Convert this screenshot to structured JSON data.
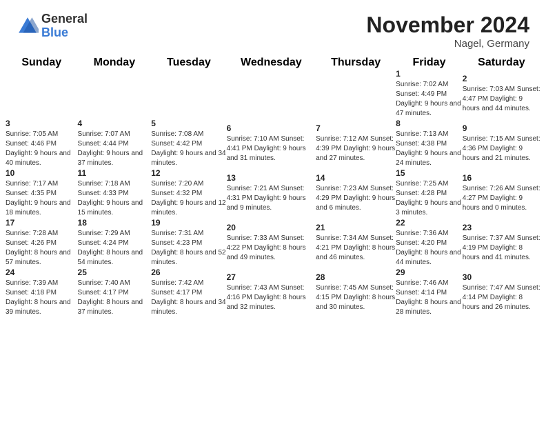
{
  "logo": {
    "general": "General",
    "blue": "Blue"
  },
  "title": "November 2024",
  "location": "Nagel, Germany",
  "days_of_week": [
    "Sunday",
    "Monday",
    "Tuesday",
    "Wednesday",
    "Thursday",
    "Friday",
    "Saturday"
  ],
  "weeks": [
    [
      {
        "day": "",
        "info": ""
      },
      {
        "day": "",
        "info": ""
      },
      {
        "day": "",
        "info": ""
      },
      {
        "day": "",
        "info": ""
      },
      {
        "day": "",
        "info": ""
      },
      {
        "day": "1",
        "info": "Sunrise: 7:02 AM\nSunset: 4:49 PM\nDaylight: 9 hours and 47 minutes."
      },
      {
        "day": "2",
        "info": "Sunrise: 7:03 AM\nSunset: 4:47 PM\nDaylight: 9 hours and 44 minutes."
      }
    ],
    [
      {
        "day": "3",
        "info": "Sunrise: 7:05 AM\nSunset: 4:46 PM\nDaylight: 9 hours and 40 minutes."
      },
      {
        "day": "4",
        "info": "Sunrise: 7:07 AM\nSunset: 4:44 PM\nDaylight: 9 hours and 37 minutes."
      },
      {
        "day": "5",
        "info": "Sunrise: 7:08 AM\nSunset: 4:42 PM\nDaylight: 9 hours and 34 minutes."
      },
      {
        "day": "6",
        "info": "Sunrise: 7:10 AM\nSunset: 4:41 PM\nDaylight: 9 hours and 31 minutes."
      },
      {
        "day": "7",
        "info": "Sunrise: 7:12 AM\nSunset: 4:39 PM\nDaylight: 9 hours and 27 minutes."
      },
      {
        "day": "8",
        "info": "Sunrise: 7:13 AM\nSunset: 4:38 PM\nDaylight: 9 hours and 24 minutes."
      },
      {
        "day": "9",
        "info": "Sunrise: 7:15 AM\nSunset: 4:36 PM\nDaylight: 9 hours and 21 minutes."
      }
    ],
    [
      {
        "day": "10",
        "info": "Sunrise: 7:17 AM\nSunset: 4:35 PM\nDaylight: 9 hours and 18 minutes."
      },
      {
        "day": "11",
        "info": "Sunrise: 7:18 AM\nSunset: 4:33 PM\nDaylight: 9 hours and 15 minutes."
      },
      {
        "day": "12",
        "info": "Sunrise: 7:20 AM\nSunset: 4:32 PM\nDaylight: 9 hours and 12 minutes."
      },
      {
        "day": "13",
        "info": "Sunrise: 7:21 AM\nSunset: 4:31 PM\nDaylight: 9 hours and 9 minutes."
      },
      {
        "day": "14",
        "info": "Sunrise: 7:23 AM\nSunset: 4:29 PM\nDaylight: 9 hours and 6 minutes."
      },
      {
        "day": "15",
        "info": "Sunrise: 7:25 AM\nSunset: 4:28 PM\nDaylight: 9 hours and 3 minutes."
      },
      {
        "day": "16",
        "info": "Sunrise: 7:26 AM\nSunset: 4:27 PM\nDaylight: 9 hours and 0 minutes."
      }
    ],
    [
      {
        "day": "17",
        "info": "Sunrise: 7:28 AM\nSunset: 4:26 PM\nDaylight: 8 hours and 57 minutes."
      },
      {
        "day": "18",
        "info": "Sunrise: 7:29 AM\nSunset: 4:24 PM\nDaylight: 8 hours and 54 minutes."
      },
      {
        "day": "19",
        "info": "Sunrise: 7:31 AM\nSunset: 4:23 PM\nDaylight: 8 hours and 52 minutes."
      },
      {
        "day": "20",
        "info": "Sunrise: 7:33 AM\nSunset: 4:22 PM\nDaylight: 8 hours and 49 minutes."
      },
      {
        "day": "21",
        "info": "Sunrise: 7:34 AM\nSunset: 4:21 PM\nDaylight: 8 hours and 46 minutes."
      },
      {
        "day": "22",
        "info": "Sunrise: 7:36 AM\nSunset: 4:20 PM\nDaylight: 8 hours and 44 minutes."
      },
      {
        "day": "23",
        "info": "Sunrise: 7:37 AM\nSunset: 4:19 PM\nDaylight: 8 hours and 41 minutes."
      }
    ],
    [
      {
        "day": "24",
        "info": "Sunrise: 7:39 AM\nSunset: 4:18 PM\nDaylight: 8 hours and 39 minutes."
      },
      {
        "day": "25",
        "info": "Sunrise: 7:40 AM\nSunset: 4:17 PM\nDaylight: 8 hours and 37 minutes."
      },
      {
        "day": "26",
        "info": "Sunrise: 7:42 AM\nSunset: 4:17 PM\nDaylight: 8 hours and 34 minutes."
      },
      {
        "day": "27",
        "info": "Sunrise: 7:43 AM\nSunset: 4:16 PM\nDaylight: 8 hours and 32 minutes."
      },
      {
        "day": "28",
        "info": "Sunrise: 7:45 AM\nSunset: 4:15 PM\nDaylight: 8 hours and 30 minutes."
      },
      {
        "day": "29",
        "info": "Sunrise: 7:46 AM\nSunset: 4:14 PM\nDaylight: 8 hours and 28 minutes."
      },
      {
        "day": "30",
        "info": "Sunrise: 7:47 AM\nSunset: 4:14 PM\nDaylight: 8 hours and 26 minutes."
      }
    ]
  ]
}
